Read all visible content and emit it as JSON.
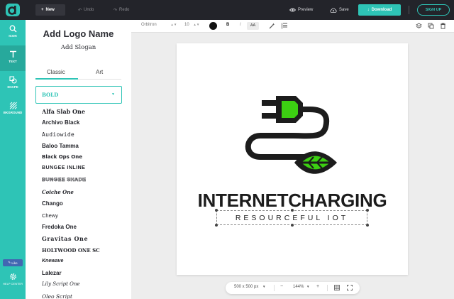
{
  "topbar": {
    "new_label": "New",
    "undo_label": "Undo",
    "redo_label": "Redo",
    "preview_label": "Preview",
    "save_label": "Save",
    "download_label": "Download",
    "signup_label": "SIGN UP"
  },
  "rail": {
    "items": [
      {
        "label": "ICON",
        "icon": "search-icon"
      },
      {
        "label": "TEXT",
        "icon": "text-icon"
      },
      {
        "label": "SHAPE",
        "icon": "shape-icon"
      },
      {
        "label": "BKGROUND",
        "icon": "background-icon"
      }
    ],
    "active": "TEXT",
    "like_label": "Like",
    "help_label": "HELP CENTER"
  },
  "panel": {
    "add_logo_name": "Add Logo Name",
    "add_slogan": "Add Slogan",
    "tabs": [
      "Classic",
      "Art"
    ],
    "active_tab": "Classic",
    "selected_font": "BOLD",
    "fonts": [
      "Alfa Slab One",
      "Archivo Black",
      "Audiowide",
      "Baloo Tamma",
      "Black Ops One",
      "BUNGEE INLINE",
      "BUNGEE SHADE",
      "Coiche One",
      "Chango",
      "Chewy",
      "Fredoka One",
      "Gravitas One",
      "HOLTWOOD ONE SC",
      "Knewave",
      "Lalezar",
      "Lily Script One",
      "Oleo Script"
    ]
  },
  "toolbar": {
    "font_name": "Orbitron",
    "font_size": "10",
    "text_color": "#111111",
    "bold_label": "B",
    "italic_label": "I",
    "case_label": "AA"
  },
  "canvas": {
    "brand_name": "INTERNETCHARGING",
    "slogan": "RESOURCEFUL IOT",
    "accent_color": "#3ccf12"
  },
  "zoombar": {
    "canvas_size": "500 x 500 px",
    "zoom_level": "144%",
    "minus_label": "−",
    "plus_label": "+"
  },
  "colors": {
    "teal": "#2ec4b6",
    "topbar": "#23242a"
  }
}
